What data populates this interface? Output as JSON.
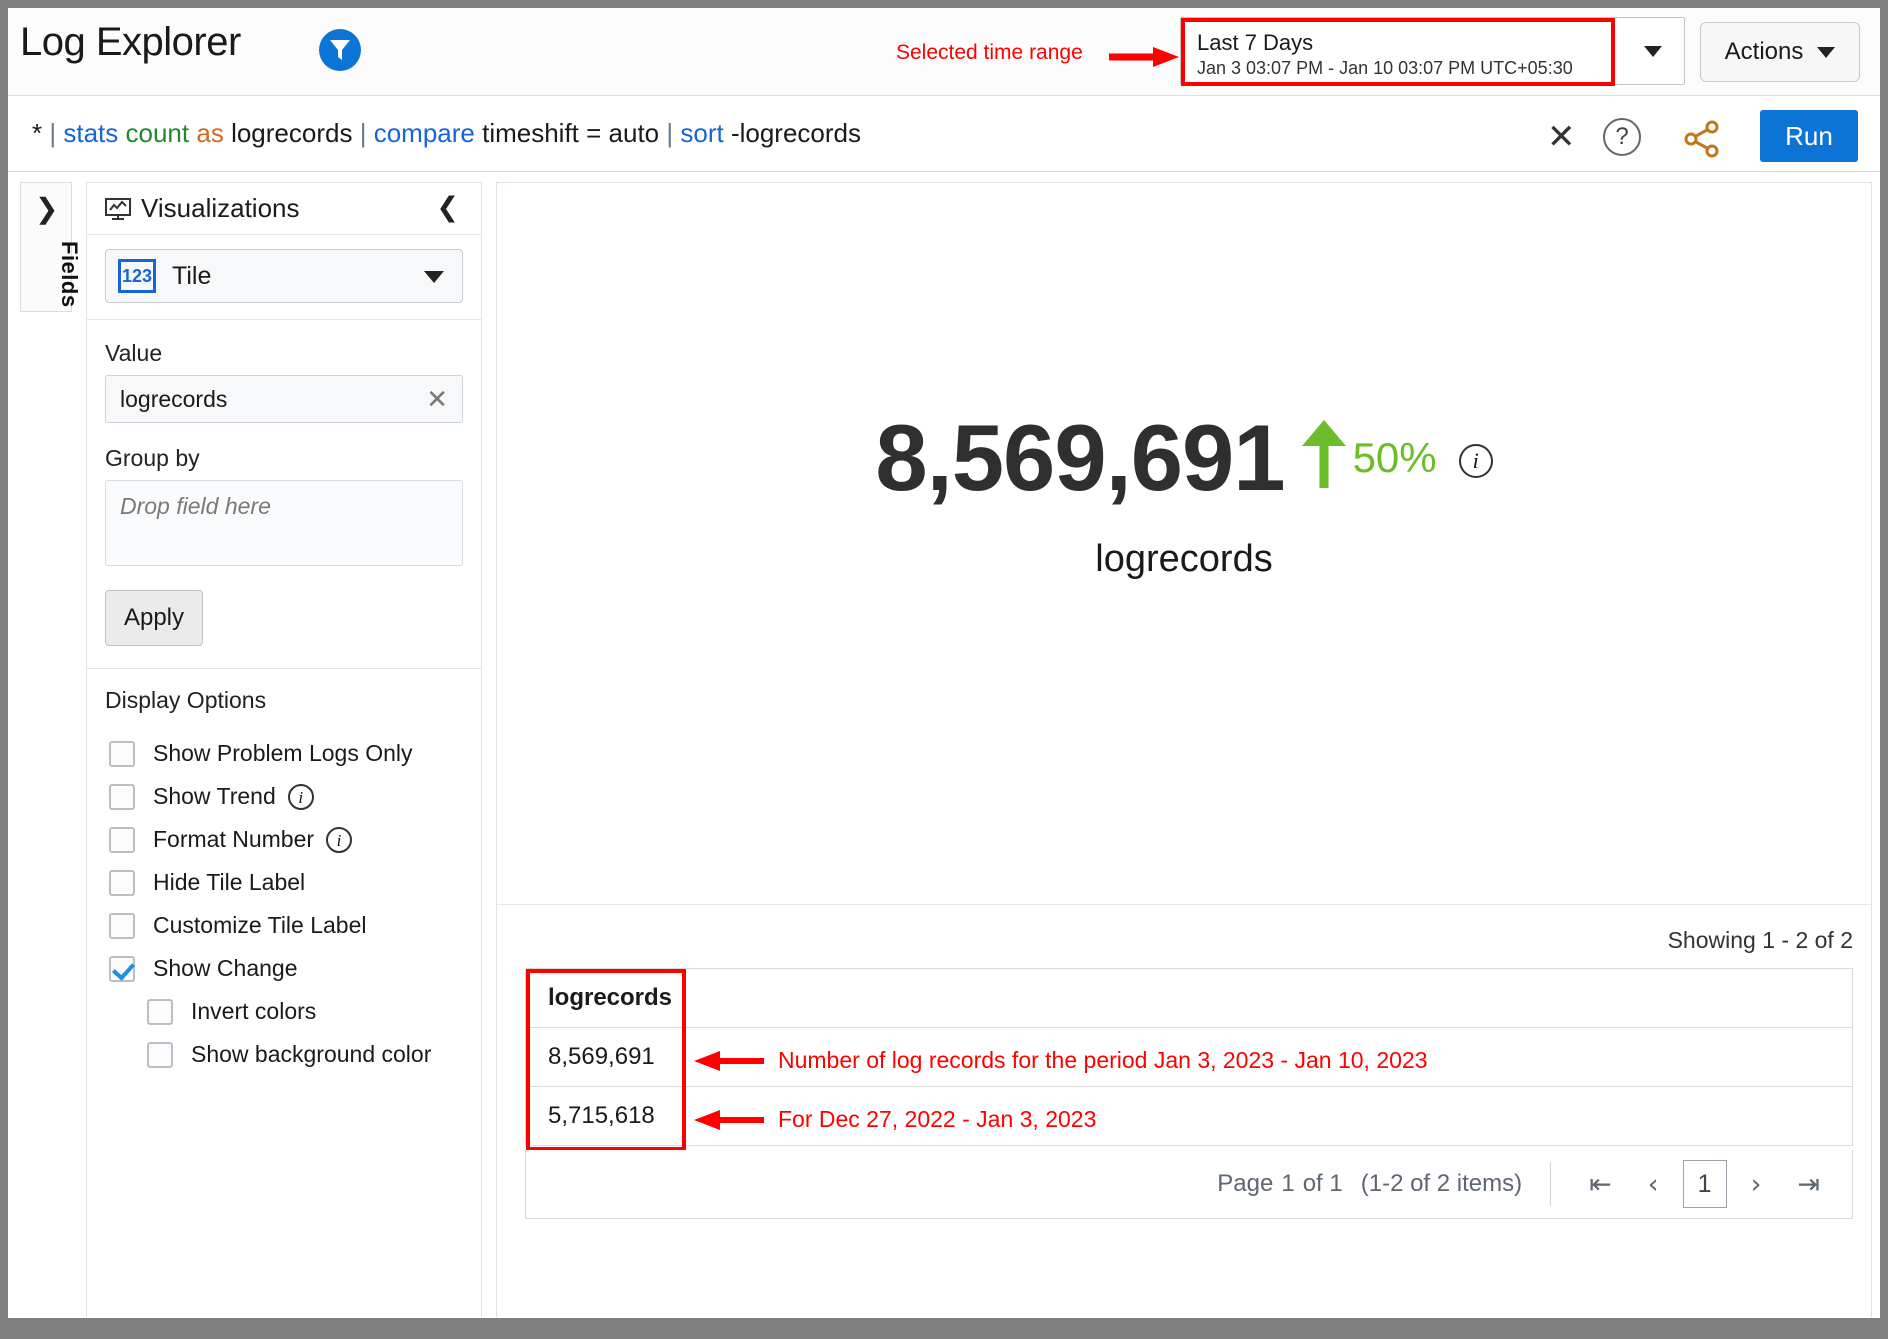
{
  "header": {
    "title": "Log Explorer",
    "funnel_icon": "funnel-icon",
    "annotation_time_range": "Selected time range",
    "time_range": {
      "label": "Last 7 Days",
      "detail": "Jan 3 03:07 PM - Jan 10 03:07 PM UTC+05:30"
    },
    "actions_label": "Actions"
  },
  "query_bar": {
    "tokens": [
      {
        "t": "*",
        "c": "plain"
      },
      {
        "t": "|",
        "c": "pipe"
      },
      {
        "t": "stats",
        "c": "kw"
      },
      {
        "t": "count",
        "c": "fn"
      },
      {
        "t": "as",
        "c": "as"
      },
      {
        "t": "logrecords",
        "c": "plain"
      },
      {
        "t": "|",
        "c": "pipe"
      },
      {
        "t": "compare",
        "c": "kw"
      },
      {
        "t": "timeshift = auto",
        "c": "plain"
      },
      {
        "t": "|",
        "c": "pipe"
      },
      {
        "t": "sort",
        "c": "kw"
      },
      {
        "t": "-logrecords",
        "c": "plain"
      }
    ],
    "full_text": "* | stats count as logrecords | compare timeshift = auto | sort -logrecords",
    "clear_icon": "close-icon",
    "help_icon": "help-icon",
    "share_icon": "share-icon",
    "run_label": "Run"
  },
  "fields_rail": {
    "label": "Fields",
    "expand_icon": "chevron-right-icon"
  },
  "visualizations": {
    "title": "Visualizations",
    "panel_icon": "monitor-chart-icon",
    "collapse_icon": "chevron-left-icon",
    "type_selected": "Tile",
    "type_icon": "123-icon",
    "value_label": "Value",
    "value_field": "logrecords",
    "group_by_label": "Group by",
    "group_by_placeholder": "Drop field here",
    "apply_label": "Apply",
    "display_options_title": "Display Options",
    "options": [
      {
        "label": "Show Problem Logs Only",
        "checked": false,
        "info": false,
        "indent": false
      },
      {
        "label": "Show Trend",
        "checked": false,
        "info": true,
        "indent": false
      },
      {
        "label": "Format Number",
        "checked": false,
        "info": true,
        "indent": false
      },
      {
        "label": "Hide Tile Label",
        "checked": false,
        "info": false,
        "indent": false
      },
      {
        "label": "Customize Tile Label",
        "checked": false,
        "info": false,
        "indent": false
      },
      {
        "label": "Show Change",
        "checked": true,
        "info": false,
        "indent": false
      },
      {
        "label": "Invert colors",
        "checked": false,
        "info": false,
        "indent": true
      },
      {
        "label": "Show background color",
        "checked": false,
        "info": false,
        "indent": true
      }
    ]
  },
  "tile": {
    "value": "8,569,691",
    "trend_direction": "up",
    "trend_pct": "50%",
    "trend_color": "#6bbd2a",
    "info_icon": "info-icon",
    "label": "logrecords"
  },
  "results": {
    "showing": "Showing 1 - 2 of 2",
    "columns": [
      "logrecords"
    ],
    "rows": [
      [
        "8,569,691"
      ],
      [
        "5,715,618"
      ]
    ],
    "annotations": [
      "Number of log records for the period Jan 3, 2023 - Jan 10, 2023",
      "For Dec 27, 2022 - Jan 3, 2023"
    ],
    "pager": {
      "page_word": "Page",
      "page_num": "1",
      "of_word": "of 1",
      "items_text": "(1-2 of 2 items)",
      "first_icon": "first-page-icon",
      "prev_icon": "prev-page-icon",
      "current_page": "1",
      "next_icon": "next-page-icon",
      "last_icon": "last-page-icon"
    }
  },
  "colors": {
    "accent_blue": "#0c74d4",
    "annotation_red": "#ff0000",
    "trend_green": "#6bbd2a",
    "keyword_blue": "#1565d8",
    "function_green": "#1f8a2f",
    "operator_orange": "#d2691e"
  }
}
